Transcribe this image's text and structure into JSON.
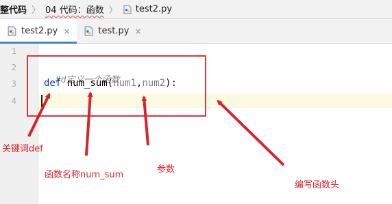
{
  "breadcrumb": {
    "project": "整代码",
    "folder": "04 代码：函数",
    "file": "test2.py"
  },
  "tabs": [
    {
      "label": "test2.py",
      "active": true
    },
    {
      "label": "test.py",
      "active": false
    }
  ],
  "tab_close_glyph": "×",
  "editor": {
    "line_numbers": [
      "1",
      "2",
      "3",
      "4"
    ],
    "comment": "#d定义一个函数",
    "def_keyword": "def",
    "function_name": "num_sum",
    "open_paren": "(",
    "param1": "num1",
    "comma": ",",
    "param2": "num2",
    "close": "):"
  },
  "annotations": {
    "keyword": "关键词def",
    "func_name": "函数名称num_sum",
    "params": "参数",
    "header": "编写函数头"
  },
  "colors": {
    "annotation_red": "#d9232b",
    "keyword_blue": "#0033b3",
    "tab_underline": "#4083c9"
  },
  "icons": {
    "folder": "folder-icon",
    "python_file": "python-file-icon",
    "close": "close-icon"
  }
}
